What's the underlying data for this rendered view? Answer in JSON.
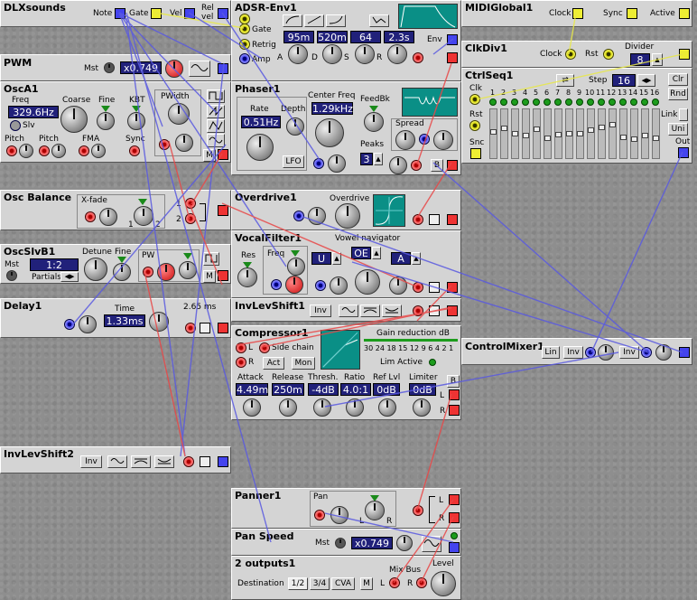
{
  "modules": {
    "dlxsounds": {
      "title": "DLXsounds",
      "note": "Note",
      "gate": "Gate",
      "vel": "Vel",
      "rel": "Rel",
      "vel2": "vel"
    },
    "adsr": {
      "title": "ADSR-Env1",
      "gate": "Gate",
      "retrig": "Retrig",
      "amp": "Amp",
      "a": "95m",
      "d": "520m",
      "s": "64",
      "r": "2.3s",
      "la": "A",
      "ld": "D",
      "ls": "S",
      "lr": "R",
      "env": "Env"
    },
    "midiglobal": {
      "title": "MIDIGlobal1",
      "clock": "Clock",
      "sync": "Sync",
      "active": "Active"
    },
    "clkdiv": {
      "title": "ClkDiv1",
      "clock": "Clock",
      "rst": "Rst",
      "divider": "Divider",
      "div_value": "8"
    },
    "ctrlseq": {
      "title": "CtrlSeq1",
      "clk": "Clk",
      "step": "Step",
      "step_value": "16",
      "clr": "Clr",
      "rnd": "Rnd",
      "rst": "Rst",
      "link": "Link",
      "uni": "Uni",
      "snc": "Snc",
      "out": "Out",
      "steps": [
        "1",
        "2",
        "3",
        "4",
        "5",
        "6",
        "7",
        "8",
        "9",
        "10",
        "11",
        "12",
        "13",
        "14",
        "15",
        "16"
      ],
      "levels": [
        0.55,
        0.62,
        0.5,
        0.45,
        0.6,
        0.4,
        0.48,
        0.5,
        0.5,
        0.58,
        0.65,
        0.7,
        0.42,
        0.38,
        0.45,
        0.4
      ]
    },
    "pwm": {
      "title": "PWM",
      "mst": "Mst",
      "value": "x0.749"
    },
    "osca": {
      "title": "OscA1",
      "freq": "Freq",
      "freq_value": "329.6Hz",
      "slv": "Slv",
      "coarse": "Coarse",
      "fine": "Fine",
      "kbt": "KBT",
      "pwidth": "PWidth",
      "pitch1": "Pitch",
      "pitch2": "Pitch",
      "fma": "FMA",
      "sync": "Sync",
      "m": "M"
    },
    "phaser": {
      "title": "Phaser1",
      "rate": "Rate",
      "rate_value": "0.51Hz",
      "depth": "Depth",
      "center": "Center Freq",
      "center_value": "1.29kHz",
      "feedbk": "FeedBk",
      "spread": "Spread",
      "peaks": "Peaks",
      "peaks_value": "3",
      "lfo": "LFO",
      "b": "B"
    },
    "oscbal": {
      "title": "Osc Balance",
      "xfade": "X-fade",
      "one": "1",
      "two": "2",
      "in1": "1",
      "in2": "2"
    },
    "overdrive": {
      "title": "Overdrive1",
      "overdrive": "Overdrive"
    },
    "oscslv": {
      "title": "OscSlvB1",
      "detune": "Detune",
      "fine": "Fine",
      "pw": "PW",
      "mst": "Mst",
      "ratio": "1:2",
      "partials": "Partials",
      "m": "M"
    },
    "vocal": {
      "title": "VocalFilter1",
      "navigator": "Vowel navigator",
      "res": "Res",
      "freq": "Freq",
      "v1": "U",
      "v2": "OE",
      "v3": "A"
    },
    "delay": {
      "title": "Delay1",
      "time": "Time",
      "time_value": "1.33ms",
      "max": "2.65 ms"
    },
    "invlev1": {
      "title": "InvLevShift1",
      "inv": "Inv"
    },
    "compressor": {
      "title": "Compressor1",
      "l": "L",
      "r": "R",
      "sidechain": "Side chain",
      "act": "Act",
      "mon": "Mon",
      "gainred": "Gain reduction dB",
      "scale": "30 24 18 15 12  9  6  4  2  1",
      "limactive": "Lim Active",
      "attack": "Attack",
      "release": "Release",
      "thresh": "Thresh.",
      "ratio": "Ratio",
      "reflvl": "Ref Lvl",
      "limiter": "Limiter",
      "attack_v": "4.49m",
      "release_v": "250m",
      "thresh_v": "-4dB",
      "ratio_v": "4.0:1",
      "reflvl_v": "0dB",
      "limiter_v": "0dB",
      "b": "B",
      "lo": "L",
      "ro": "R"
    },
    "controlmixer": {
      "title": "ControlMixer1",
      "lin": "Lin",
      "inv1": "Inv",
      "inv2": "Inv"
    },
    "invlev2": {
      "title": "InvLevShift2",
      "inv": "Inv"
    },
    "panner": {
      "title": "Panner1",
      "pan": "Pan",
      "l": "L",
      "r": "R",
      "lo": "L",
      "ro": "R"
    },
    "panspeed": {
      "title": "Pan Speed",
      "mst": "Mst",
      "value": "x0.749"
    },
    "outputs": {
      "title": "2 outputs1",
      "dest": "Destination",
      "o12": "1/2",
      "o34": "3/4",
      "cva": "CVA",
      "m": "M",
      "mixbus": "Mix Bus",
      "level": "Level",
      "l": "L",
      "r": "R"
    }
  },
  "colors": {
    "panel": "#d4d4d4",
    "display": "#21217a",
    "scope": "#0a8f86",
    "cable_red": "#e84848",
    "cable_blue": "#5a5ae0",
    "cable_yellow": "#e8e848"
  },
  "icons": [
    "sine-wave-icon",
    "square-wave-icon",
    "triangle-wave-icon",
    "saw-wave-icon",
    "envelope-shape-icon",
    "level-shift-icon"
  ]
}
